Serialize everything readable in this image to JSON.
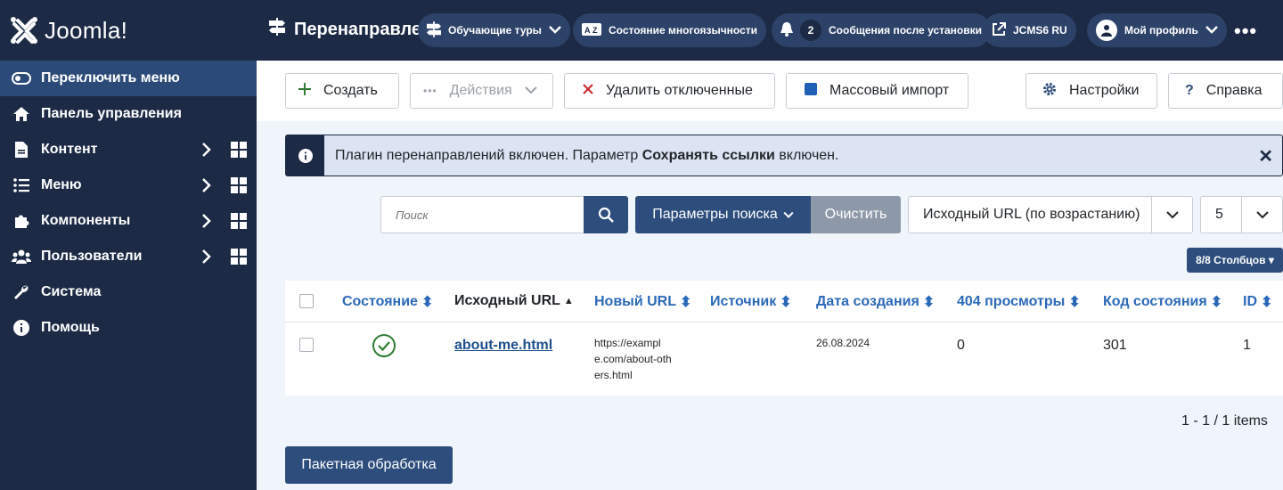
{
  "brand": {
    "name": "Joomla!",
    "colors": {
      "sidebar": "#1c2a45",
      "primary": "#2d4d7c",
      "link": "#2a69b8",
      "success": "#2f7d32"
    }
  },
  "sidebar": {
    "items": [
      {
        "label": "Переключить меню",
        "icon": "toggle-icon"
      },
      {
        "label": "Панель управления",
        "icon": "home-icon"
      },
      {
        "label": "Контент",
        "icon": "file-icon"
      },
      {
        "label": "Меню",
        "icon": "list-icon"
      },
      {
        "label": "Компоненты",
        "icon": "puzzle-icon"
      },
      {
        "label": "Пользователи",
        "icon": "users-icon"
      },
      {
        "label": "Система",
        "icon": "wrench-icon"
      },
      {
        "label": "Помощь",
        "icon": "info-icon"
      }
    ]
  },
  "header": {
    "title": "Перенаправлен",
    "guided_tours": "Обучающие туры",
    "multilang": "Состояние многоязычности",
    "messages_count": "2",
    "messages": "Сообщения после установки",
    "site": "JCMS6 RU",
    "profile": "Мой профиль",
    "more": "•••"
  },
  "toolbar": {
    "create": "Создать",
    "actions": "Действия",
    "delete_disabled": "Удалить отключенные",
    "bulk_import": "Массовый импорт",
    "options": "Настройки",
    "help": "Справка"
  },
  "alert": {
    "text_before": "Плагин перенаправлений включен. Параметр ",
    "text_bold": "Сохранять ссылки",
    "text_after": " включен."
  },
  "filters": {
    "search_placeholder": "Поиск",
    "search_options": "Параметры поиска",
    "clear": "Очистить",
    "ordering": "Исходный URL (по возрастанию)",
    "limit": "5",
    "columns": "8/8 Столбцов"
  },
  "table": {
    "headers": {
      "status": "Состояние",
      "old_url": "Исходный URL",
      "new_url": "Новый URL",
      "referer": "Источник",
      "created": "Дата создания",
      "hits": "404 просмотры",
      "code": "Код состояния",
      "id": "ID"
    },
    "rows": [
      {
        "status": "published",
        "old_url": "about-me.html",
        "new_url_lines": [
          "https://exampl",
          "e.com/about-oth",
          "ers.html"
        ],
        "referer": "",
        "created": "26.08.2024",
        "hits": "0",
        "code": "301",
        "id": "1"
      }
    ]
  },
  "pagination": {
    "info": "1 - 1 / 1 items"
  },
  "batch": {
    "label": "Пакетная обработка"
  }
}
